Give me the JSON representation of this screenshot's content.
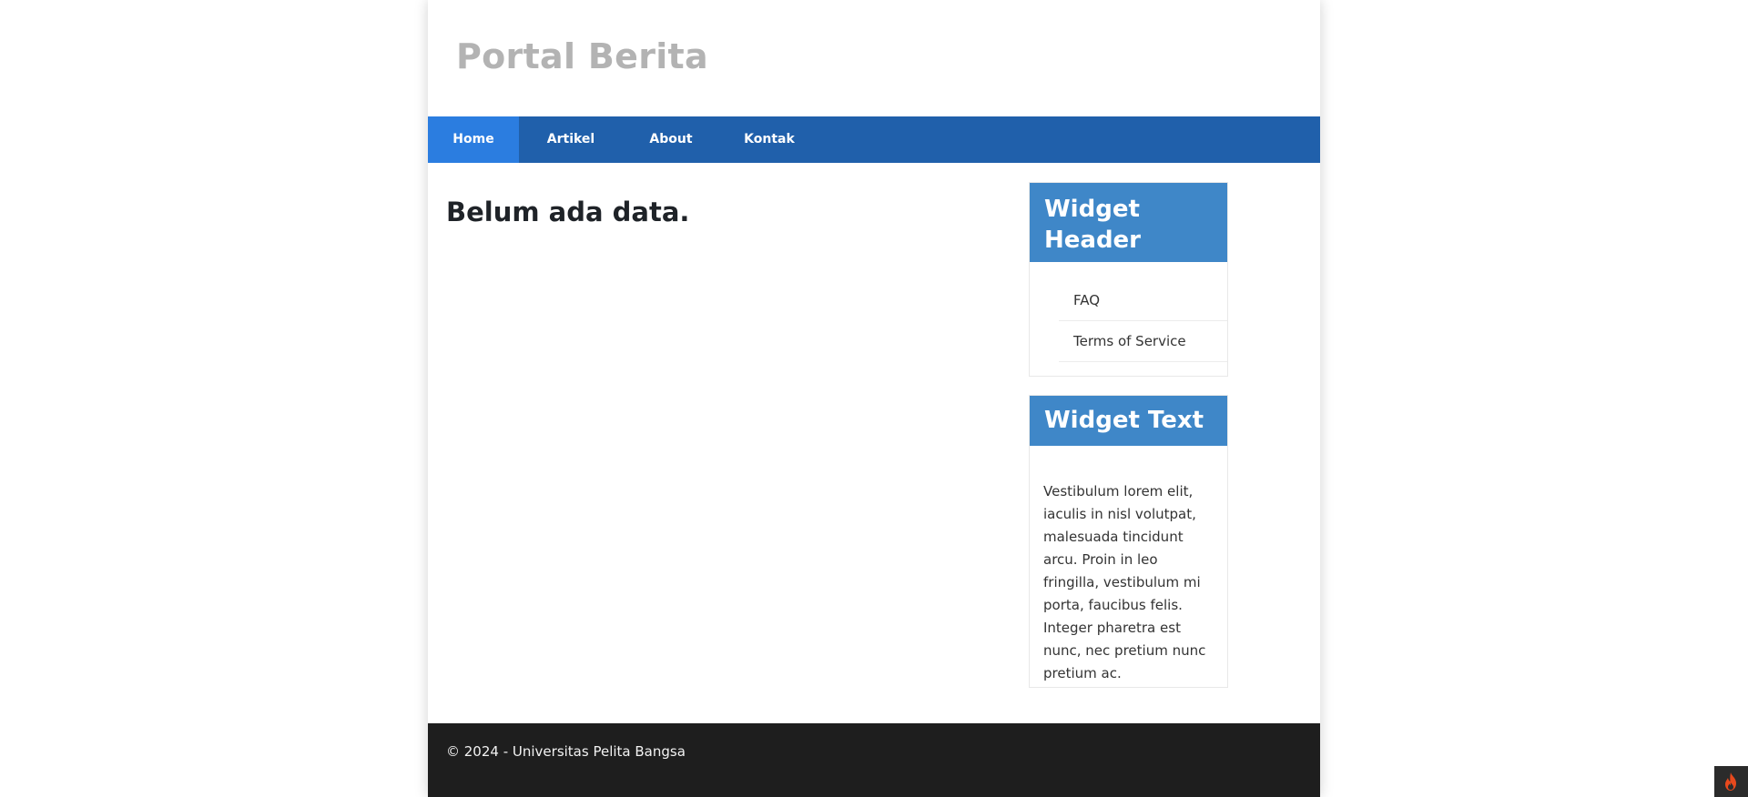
{
  "header": {
    "site_title": "Portal Berita"
  },
  "nav": {
    "items": [
      {
        "label": "Home",
        "active": true
      },
      {
        "label": "Artikel"
      },
      {
        "label": "About"
      },
      {
        "label": "Kontak"
      }
    ]
  },
  "main": {
    "heading": "Belum ada data."
  },
  "sidebar": {
    "widget_header": {
      "title": "Widget Header",
      "links": [
        "FAQ",
        "Terms of Service"
      ]
    },
    "widget_text": {
      "title": "Widget Text",
      "body": "Vestibulum lorem elit, iaculis in nisl volutpat, malesuada tincidunt arcu. Proin in leo fringilla, vestibulum mi porta, faucibus felis. Integer pharetra est nunc, nec pretium nunc pretium ac."
    }
  },
  "footer": {
    "text": "© 2024 - Universitas Pelita Bangsa"
  },
  "corner_badge": {
    "icon": "flame-icon"
  },
  "colors": {
    "nav_bg": "#2060ab",
    "nav_active": "#2b7de0",
    "widget_title_bg": "#3f87c8",
    "footer_bg": "#1e1e1e",
    "site_title": "#b3b3b3"
  }
}
